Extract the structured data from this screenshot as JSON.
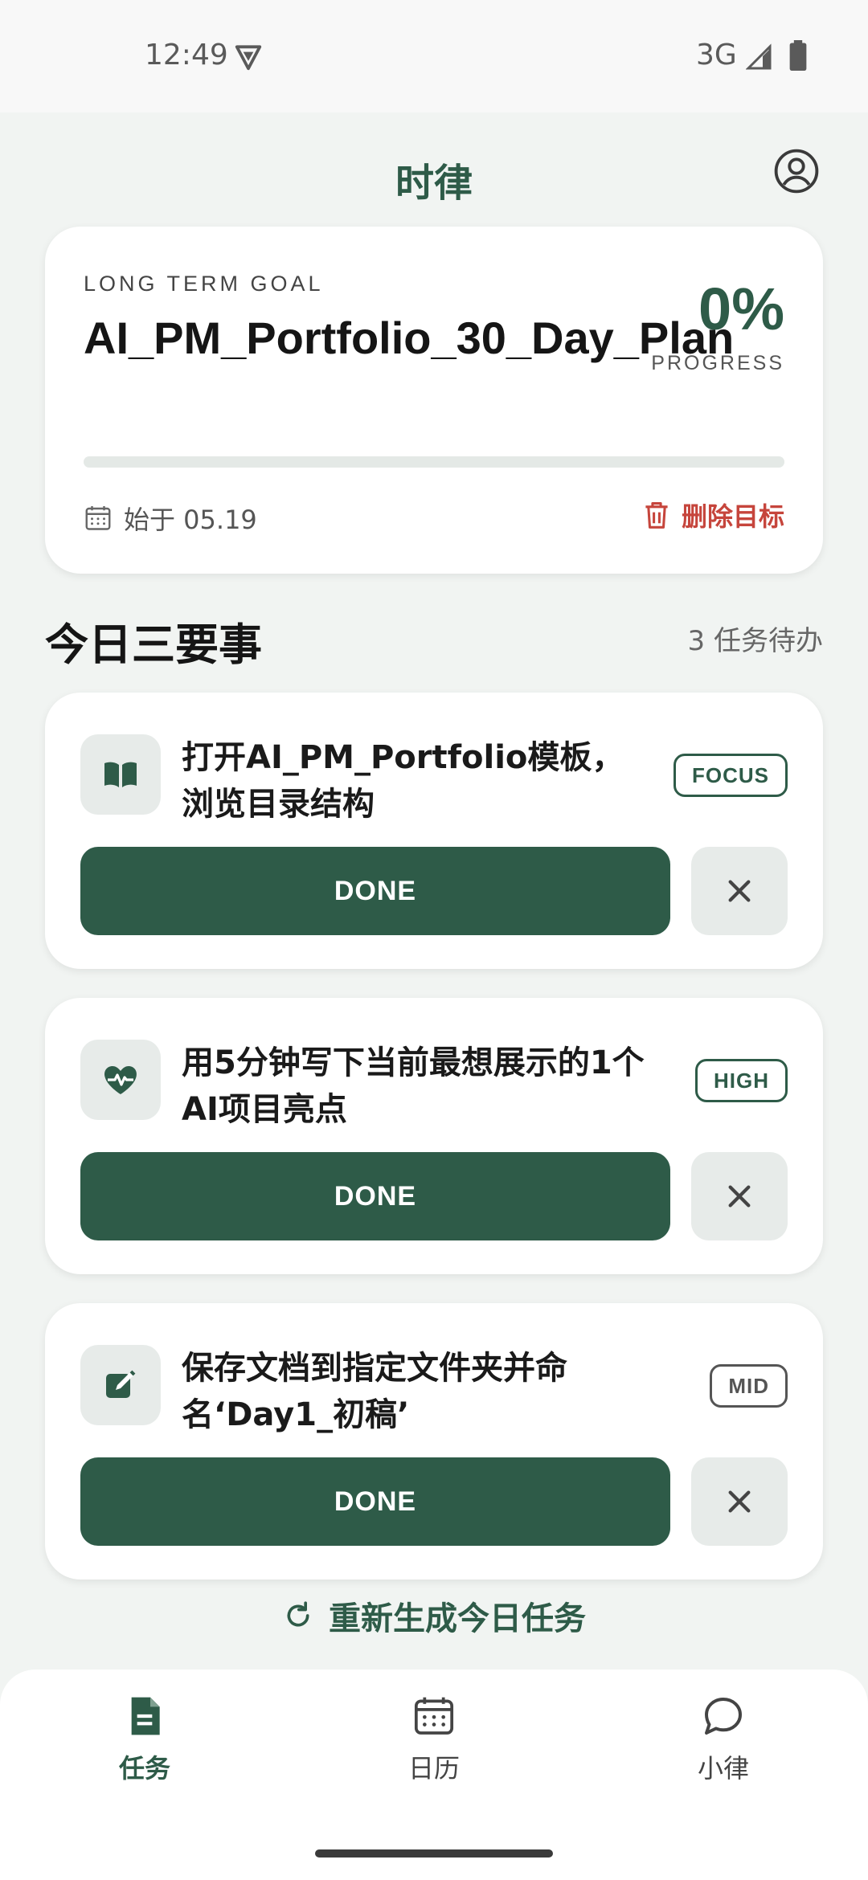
{
  "status_bar": {
    "time": "12:49",
    "network": "3G",
    "icons": [
      "vpn-shield-icon",
      "signal-icon",
      "battery-icon"
    ]
  },
  "app_bar": {
    "title": "时律",
    "account_icon": "account-circle-icon"
  },
  "goal": {
    "label": "LONG TERM GOAL",
    "title": "AI_PM_Portfolio_30_Day_Plan",
    "percent_text": "0%",
    "progress_label": "PROGRESS",
    "progress_value": 0,
    "start_date": "始于 05.19",
    "delete_label": "删除目标"
  },
  "today": {
    "title": "今日三要事",
    "count": "3 任务待办",
    "tasks": [
      {
        "text": "打开AI_PM_Portfolio模板，浏览目录结构",
        "badge": "FOCUS",
        "done_label": "DONE",
        "icon": "book-icon"
      },
      {
        "text": "用5分钟写下当前最想展示的1个AI项目亮点",
        "badge": "HIGH",
        "done_label": "DONE",
        "icon": "heart-pulse-icon"
      },
      {
        "text": "保存文档到指定文件夹并命名‘Day1_初稿’",
        "badge": "MID",
        "done_label": "DONE",
        "icon": "edit-icon"
      }
    ]
  },
  "regenerate_label": "重新生成今日任务",
  "nav": {
    "items": [
      {
        "label": "任务",
        "icon": "task-document-icon",
        "active": true
      },
      {
        "label": "日历",
        "icon": "calendar-icon",
        "active": false
      },
      {
        "label": "小律",
        "icon": "chat-bubble-icon",
        "active": false
      }
    ]
  },
  "colors": {
    "accent": "#2e5b48",
    "danger": "#c6453c",
    "background": "#f1f4f2"
  }
}
